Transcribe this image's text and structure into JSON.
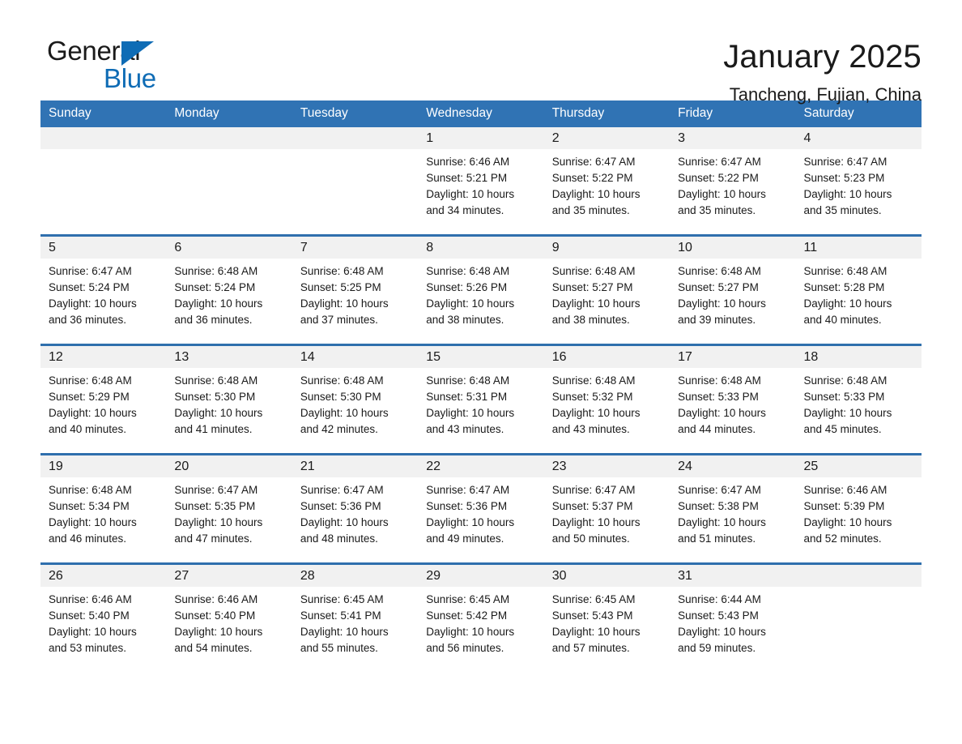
{
  "brand": {
    "name_part1": "General",
    "name_part2": "Blue",
    "accent_color": "#0f6cb5"
  },
  "header": {
    "month_title": "January 2025",
    "location": "Tancheng, Fujian, China"
  },
  "theme": {
    "header_blue": "#3073b4",
    "separator_blue": "#2f6fad",
    "daynum_band": "#f1f1f1"
  },
  "calendar": {
    "weekday_headers": [
      "Sunday",
      "Monday",
      "Tuesday",
      "Wednesday",
      "Thursday",
      "Friday",
      "Saturday"
    ],
    "weeks": [
      [
        {
          "day": "",
          "empty": true
        },
        {
          "day": "",
          "empty": true
        },
        {
          "day": "",
          "empty": true
        },
        {
          "day": "1",
          "sunrise": "Sunrise: 6:46 AM",
          "sunset": "Sunset: 5:21 PM",
          "daylight_line1": "Daylight: 10 hours",
          "daylight_line2": "and 34 minutes."
        },
        {
          "day": "2",
          "sunrise": "Sunrise: 6:47 AM",
          "sunset": "Sunset: 5:22 PM",
          "daylight_line1": "Daylight: 10 hours",
          "daylight_line2": "and 35 minutes."
        },
        {
          "day": "3",
          "sunrise": "Sunrise: 6:47 AM",
          "sunset": "Sunset: 5:22 PM",
          "daylight_line1": "Daylight: 10 hours",
          "daylight_line2": "and 35 minutes."
        },
        {
          "day": "4",
          "sunrise": "Sunrise: 6:47 AM",
          "sunset": "Sunset: 5:23 PM",
          "daylight_line1": "Daylight: 10 hours",
          "daylight_line2": "and 35 minutes."
        }
      ],
      [
        {
          "day": "5",
          "sunrise": "Sunrise: 6:47 AM",
          "sunset": "Sunset: 5:24 PM",
          "daylight_line1": "Daylight: 10 hours",
          "daylight_line2": "and 36 minutes."
        },
        {
          "day": "6",
          "sunrise": "Sunrise: 6:48 AM",
          "sunset": "Sunset: 5:24 PM",
          "daylight_line1": "Daylight: 10 hours",
          "daylight_line2": "and 36 minutes."
        },
        {
          "day": "7",
          "sunrise": "Sunrise: 6:48 AM",
          "sunset": "Sunset: 5:25 PM",
          "daylight_line1": "Daylight: 10 hours",
          "daylight_line2": "and 37 minutes."
        },
        {
          "day": "8",
          "sunrise": "Sunrise: 6:48 AM",
          "sunset": "Sunset: 5:26 PM",
          "daylight_line1": "Daylight: 10 hours",
          "daylight_line2": "and 38 minutes."
        },
        {
          "day": "9",
          "sunrise": "Sunrise: 6:48 AM",
          "sunset": "Sunset: 5:27 PM",
          "daylight_line1": "Daylight: 10 hours",
          "daylight_line2": "and 38 minutes."
        },
        {
          "day": "10",
          "sunrise": "Sunrise: 6:48 AM",
          "sunset": "Sunset: 5:27 PM",
          "daylight_line1": "Daylight: 10 hours",
          "daylight_line2": "and 39 minutes."
        },
        {
          "day": "11",
          "sunrise": "Sunrise: 6:48 AM",
          "sunset": "Sunset: 5:28 PM",
          "daylight_line1": "Daylight: 10 hours",
          "daylight_line2": "and 40 minutes."
        }
      ],
      [
        {
          "day": "12",
          "sunrise": "Sunrise: 6:48 AM",
          "sunset": "Sunset: 5:29 PM",
          "daylight_line1": "Daylight: 10 hours",
          "daylight_line2": "and 40 minutes."
        },
        {
          "day": "13",
          "sunrise": "Sunrise: 6:48 AM",
          "sunset": "Sunset: 5:30 PM",
          "daylight_line1": "Daylight: 10 hours",
          "daylight_line2": "and 41 minutes."
        },
        {
          "day": "14",
          "sunrise": "Sunrise: 6:48 AM",
          "sunset": "Sunset: 5:30 PM",
          "daylight_line1": "Daylight: 10 hours",
          "daylight_line2": "and 42 minutes."
        },
        {
          "day": "15",
          "sunrise": "Sunrise: 6:48 AM",
          "sunset": "Sunset: 5:31 PM",
          "daylight_line1": "Daylight: 10 hours",
          "daylight_line2": "and 43 minutes."
        },
        {
          "day": "16",
          "sunrise": "Sunrise: 6:48 AM",
          "sunset": "Sunset: 5:32 PM",
          "daylight_line1": "Daylight: 10 hours",
          "daylight_line2": "and 43 minutes."
        },
        {
          "day": "17",
          "sunrise": "Sunrise: 6:48 AM",
          "sunset": "Sunset: 5:33 PM",
          "daylight_line1": "Daylight: 10 hours",
          "daylight_line2": "and 44 minutes."
        },
        {
          "day": "18",
          "sunrise": "Sunrise: 6:48 AM",
          "sunset": "Sunset: 5:33 PM",
          "daylight_line1": "Daylight: 10 hours",
          "daylight_line2": "and 45 minutes."
        }
      ],
      [
        {
          "day": "19",
          "sunrise": "Sunrise: 6:48 AM",
          "sunset": "Sunset: 5:34 PM",
          "daylight_line1": "Daylight: 10 hours",
          "daylight_line2": "and 46 minutes."
        },
        {
          "day": "20",
          "sunrise": "Sunrise: 6:47 AM",
          "sunset": "Sunset: 5:35 PM",
          "daylight_line1": "Daylight: 10 hours",
          "daylight_line2": "and 47 minutes."
        },
        {
          "day": "21",
          "sunrise": "Sunrise: 6:47 AM",
          "sunset": "Sunset: 5:36 PM",
          "daylight_line1": "Daylight: 10 hours",
          "daylight_line2": "and 48 minutes."
        },
        {
          "day": "22",
          "sunrise": "Sunrise: 6:47 AM",
          "sunset": "Sunset: 5:36 PM",
          "daylight_line1": "Daylight: 10 hours",
          "daylight_line2": "and 49 minutes."
        },
        {
          "day": "23",
          "sunrise": "Sunrise: 6:47 AM",
          "sunset": "Sunset: 5:37 PM",
          "daylight_line1": "Daylight: 10 hours",
          "daylight_line2": "and 50 minutes."
        },
        {
          "day": "24",
          "sunrise": "Sunrise: 6:47 AM",
          "sunset": "Sunset: 5:38 PM",
          "daylight_line1": "Daylight: 10 hours",
          "daylight_line2": "and 51 minutes."
        },
        {
          "day": "25",
          "sunrise": "Sunrise: 6:46 AM",
          "sunset": "Sunset: 5:39 PM",
          "daylight_line1": "Daylight: 10 hours",
          "daylight_line2": "and 52 minutes."
        }
      ],
      [
        {
          "day": "26",
          "sunrise": "Sunrise: 6:46 AM",
          "sunset": "Sunset: 5:40 PM",
          "daylight_line1": "Daylight: 10 hours",
          "daylight_line2": "and 53 minutes."
        },
        {
          "day": "27",
          "sunrise": "Sunrise: 6:46 AM",
          "sunset": "Sunset: 5:40 PM",
          "daylight_line1": "Daylight: 10 hours",
          "daylight_line2": "and 54 minutes."
        },
        {
          "day": "28",
          "sunrise": "Sunrise: 6:45 AM",
          "sunset": "Sunset: 5:41 PM",
          "daylight_line1": "Daylight: 10 hours",
          "daylight_line2": "and 55 minutes."
        },
        {
          "day": "29",
          "sunrise": "Sunrise: 6:45 AM",
          "sunset": "Sunset: 5:42 PM",
          "daylight_line1": "Daylight: 10 hours",
          "daylight_line2": "and 56 minutes."
        },
        {
          "day": "30",
          "sunrise": "Sunrise: 6:45 AM",
          "sunset": "Sunset: 5:43 PM",
          "daylight_line1": "Daylight: 10 hours",
          "daylight_line2": "and 57 minutes."
        },
        {
          "day": "31",
          "sunrise": "Sunrise: 6:44 AM",
          "sunset": "Sunset: 5:43 PM",
          "daylight_line1": "Daylight: 10 hours",
          "daylight_line2": "and 59 minutes."
        },
        {
          "day": "",
          "empty": true
        }
      ]
    ]
  }
}
